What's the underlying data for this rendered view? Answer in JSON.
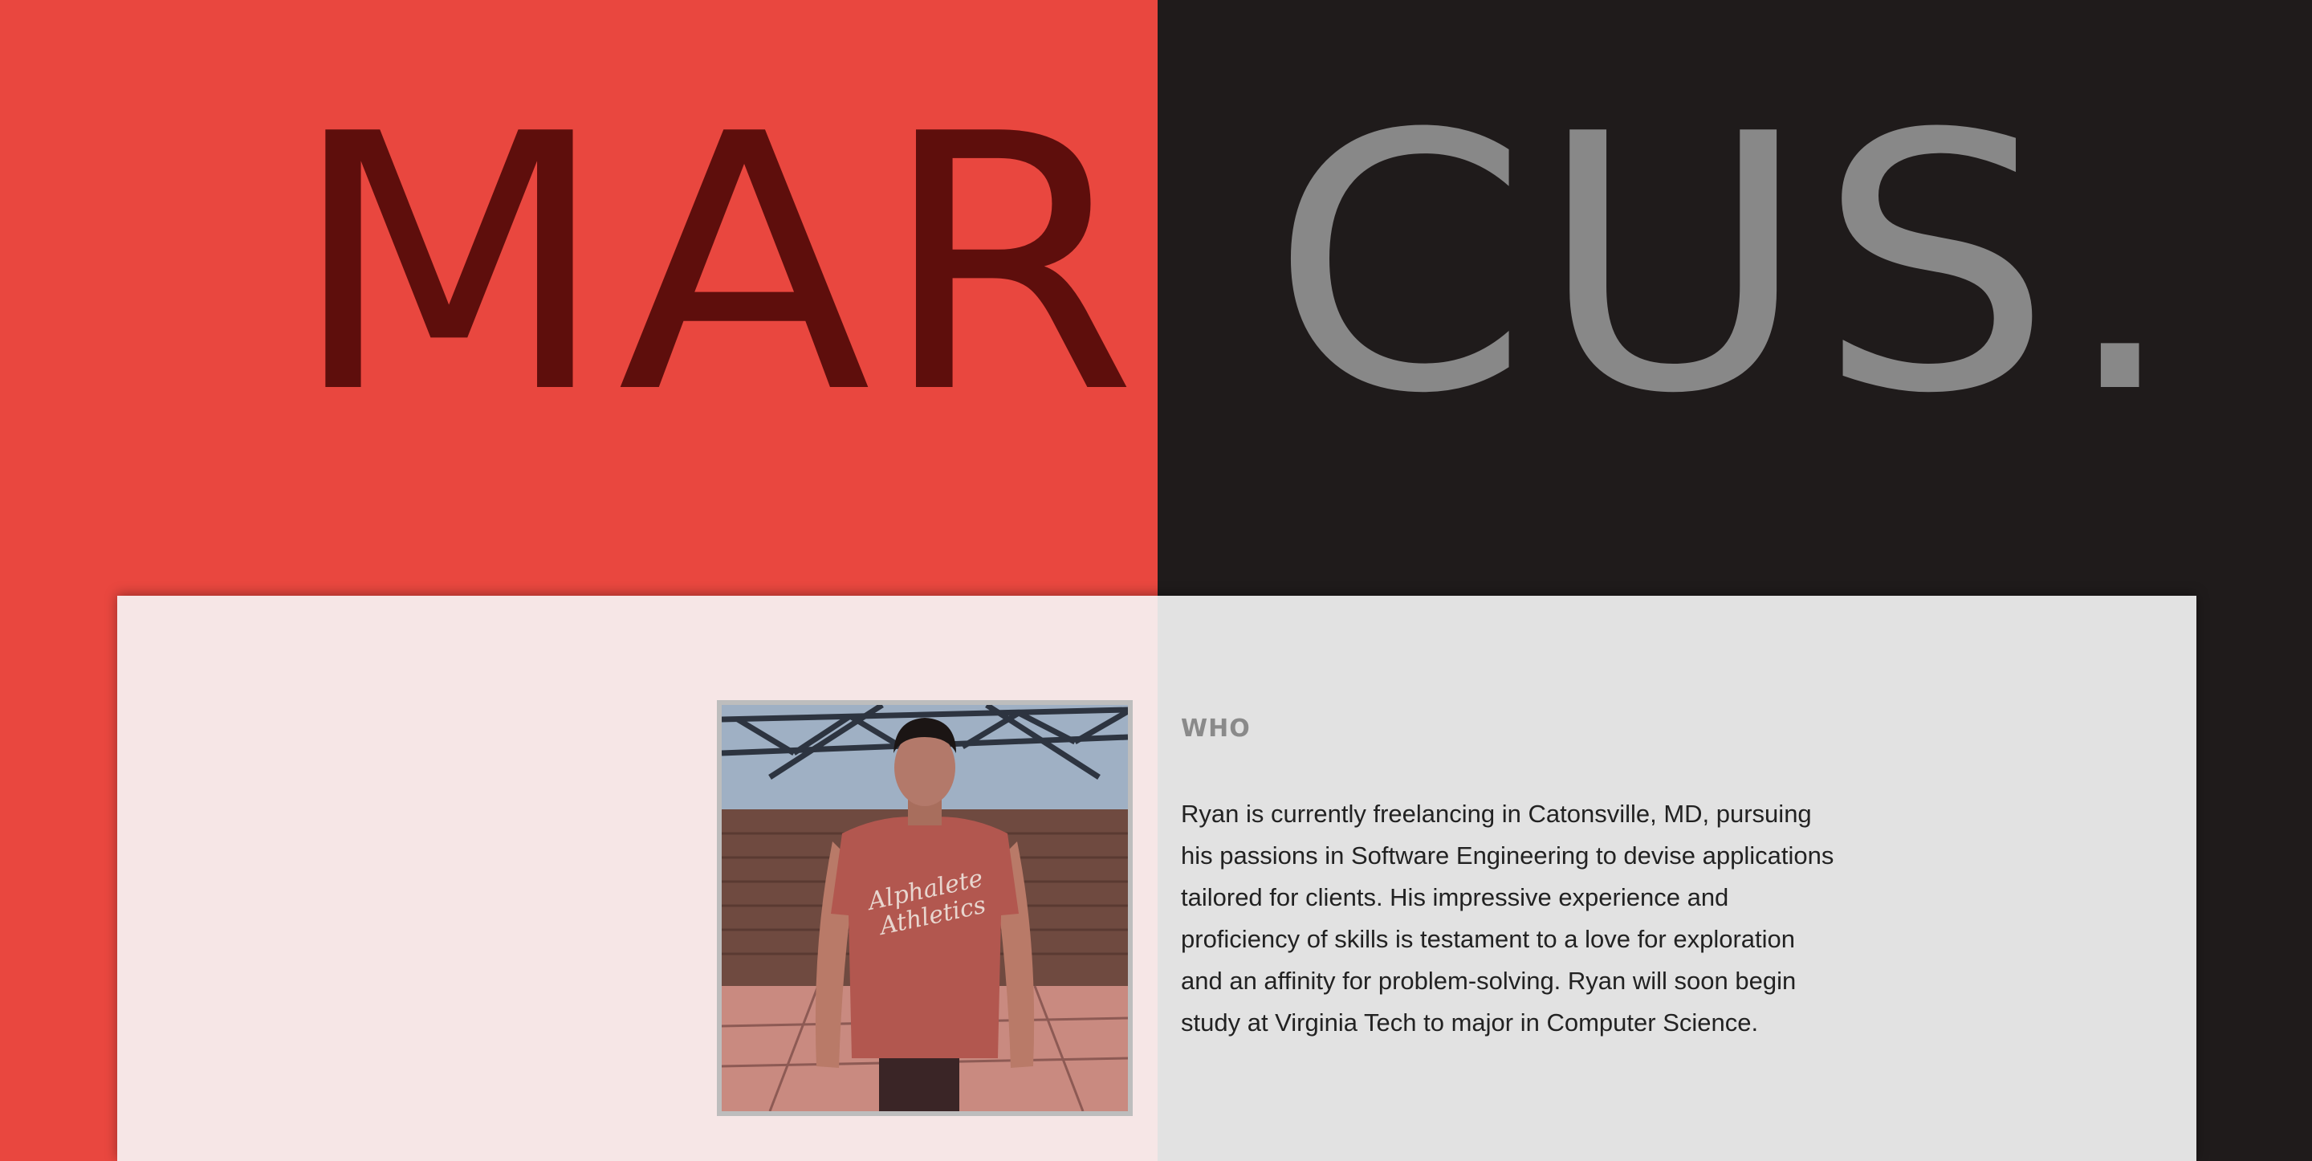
{
  "colors": {
    "left_bg": "#e9473f",
    "right_bg": "#1f1b1b",
    "hero_left_text": "#5e0e0c",
    "hero_right_text": "#888888",
    "card_left_bg": "#f6e6e6",
    "card_right_bg": "#e2e2e2",
    "label_text": "#8a8a8a",
    "body_text": "#222222"
  },
  "hero": {
    "left_text": "MAR",
    "right_text": "CUS."
  },
  "about": {
    "photo_icon": "portrait-photo-icon",
    "photo_shirt_text": "Alphalete Athletics",
    "label": "WHO",
    "bio": "Ryan is currently freelancing in Catonsville, MD, pursuing his passions in Software Engineering to devise applications tailored for clients. His impressive experience and proficiency of skills is testament to a love for exploration and an affinity for problem-solving. Ryan will soon begin study at Virginia Tech to major in Computer Science."
  }
}
